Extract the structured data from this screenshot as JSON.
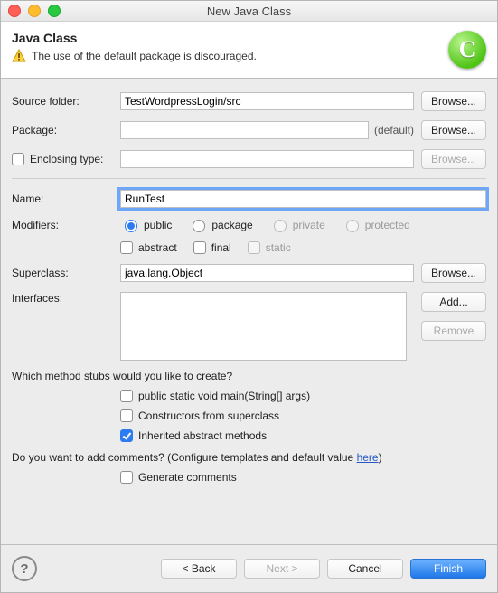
{
  "window": {
    "title": "New Java Class"
  },
  "header": {
    "heading": "Java Class",
    "warning": "The use of the default package is discouraged."
  },
  "form": {
    "sourceFolder": {
      "label": "Source folder:",
      "value": "TestWordpressLogin/src",
      "browse": "Browse..."
    },
    "package": {
      "label": "Package:",
      "value": "",
      "hint": "(default)",
      "browse": "Browse..."
    },
    "enclosingType": {
      "label": "Enclosing type:",
      "value": "",
      "browse": "Browse..."
    },
    "name": {
      "label": "Name:",
      "value": "RunTest"
    },
    "modifiers": {
      "label": "Modifiers:",
      "public": "public",
      "package": "package",
      "private": "private",
      "protected": "protected",
      "abstract": "abstract",
      "final": "final",
      "static": "static"
    },
    "superclass": {
      "label": "Superclass:",
      "value": "java.lang.Object",
      "browse": "Browse..."
    },
    "interfaces": {
      "label": "Interfaces:",
      "add": "Add...",
      "remove": "Remove"
    },
    "stubsQuestion": "Which method stubs would you like to create?",
    "stubs": {
      "main": "public static void main(String[] args)",
      "constructors": "Constructors from superclass",
      "inherited": "Inherited abstract methods"
    },
    "commentsQuestion": {
      "prefix": "Do you want to add comments? (Configure templates and default value ",
      "link": "here",
      "suffix": ")"
    },
    "generateComments": "Generate comments"
  },
  "footer": {
    "back": "< Back",
    "next": "Next >",
    "cancel": "Cancel",
    "finish": "Finish"
  }
}
